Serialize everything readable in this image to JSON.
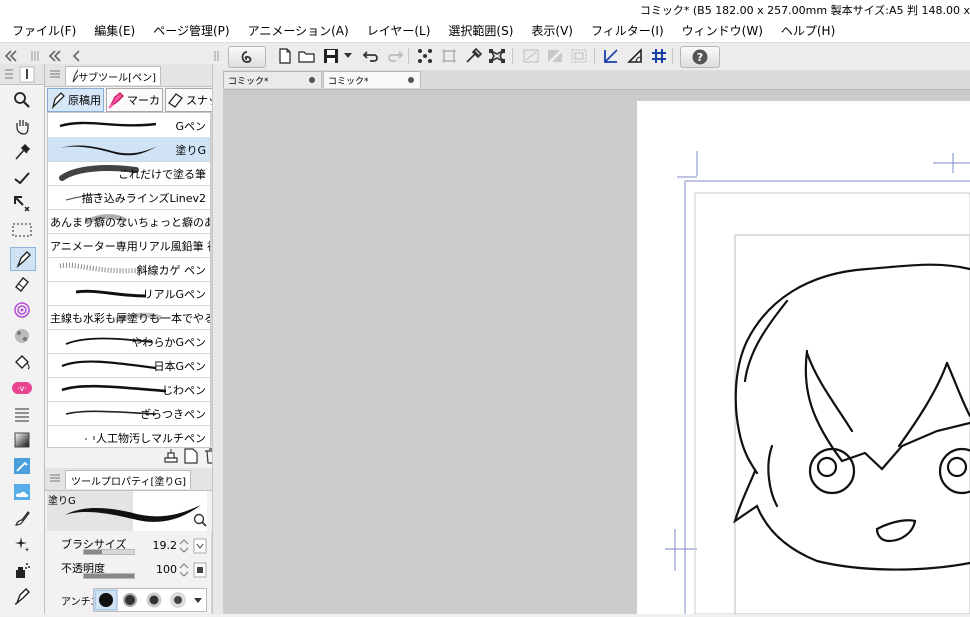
{
  "window": {
    "title": "コミック* (B5 182.00 x 257.00mm 製本サイズ:A5 判 148.00 x"
  },
  "menu": [
    "ファイル(F)",
    "編集(E)",
    "ページ管理(P)",
    "アニメーション(A)",
    "レイヤー(L)",
    "選択範囲(S)",
    "表示(V)",
    "フィルター(I)",
    "ウィンドウ(W)",
    "ヘルプ(H)"
  ],
  "subtool_panel": {
    "tab_label": "サブツール[ペン]",
    "groups": [
      "原稿用",
      "マーカ",
      "スナッ"
    ],
    "brushes": [
      {
        "name": "Gペン"
      },
      {
        "name": "塗りG",
        "selected": true
      },
      {
        "name": "これだけで塗る筆"
      },
      {
        "name": "描き込みラインズLinev2"
      },
      {
        "name": "あんまり癖のないちょっと癖のある"
      },
      {
        "name": "アニメーター専用リアル風鉛筆 社"
      },
      {
        "name": "斜線カゲ ペン"
      },
      {
        "name": "リアルGペン"
      },
      {
        "name": "主線も水彩も厚塗りも一本でやる"
      },
      {
        "name": "やわらかGペン"
      },
      {
        "name": "日本Gペン"
      },
      {
        "name": "じわペン"
      },
      {
        "name": "ざらつきペン"
      },
      {
        "name": "人工物汚しマルチペン"
      }
    ]
  },
  "tool_property": {
    "tab_label": "ツールプロパティ[塗りG]",
    "brush_name": "塗りG",
    "brush_size_label": "ブラシサイズ",
    "brush_size_value": "19.2",
    "brush_size_level": 0.35,
    "opacity_label": "不透明度",
    "opacity_value": "100",
    "opacity_level": 1.0,
    "antialias_label": "アンチエ"
  },
  "document_tabs": [
    {
      "label": "コミック*",
      "active": false
    },
    {
      "label": "コミック*",
      "active": true
    }
  ],
  "colors": {
    "accent": "#cfe3f5",
    "canvas_bg": "#cbcbcb",
    "page": "#ffffff"
  }
}
